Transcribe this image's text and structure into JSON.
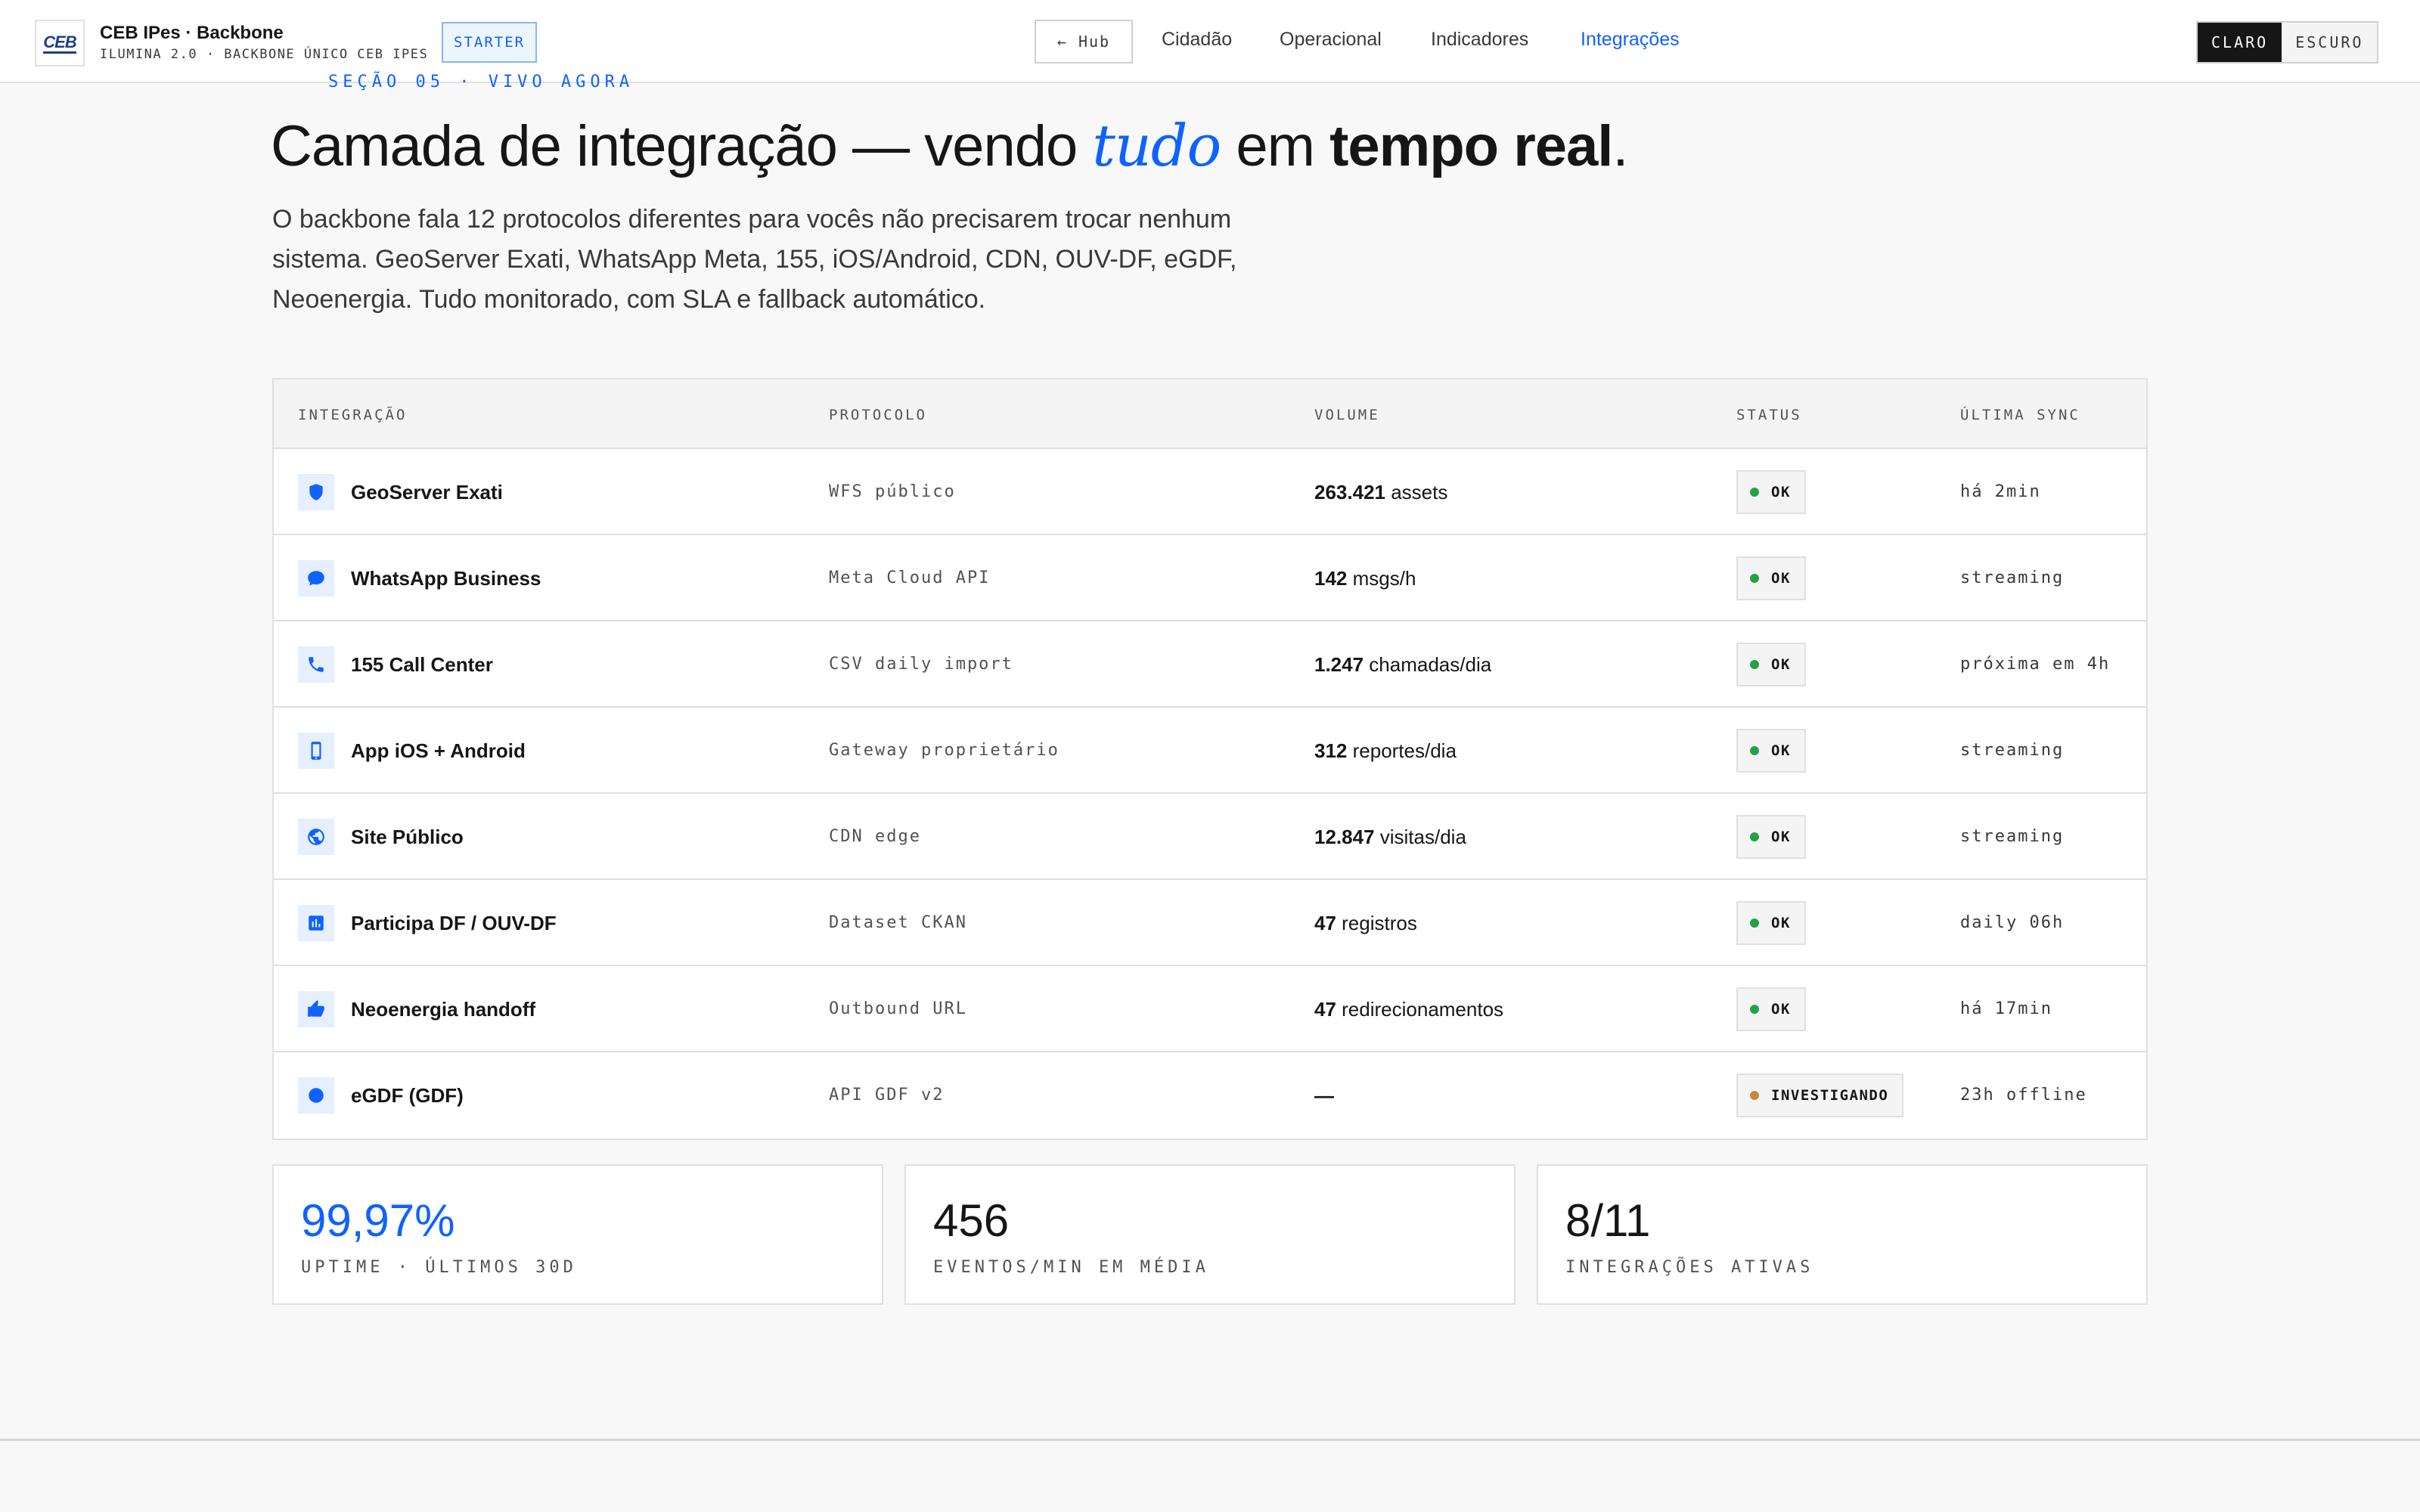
{
  "header": {
    "logo_text": "CEB",
    "brand_name": "CEB IPes · Backbone",
    "brand_sub": "ILUMINA 2.0 · BACKBONE ÚNICO CEB IPES",
    "plan_badge": "STARTER",
    "hub_button": "← Hub",
    "nav": [
      {
        "label": "Cidadão",
        "active": false
      },
      {
        "label": "Operacional",
        "active": false
      },
      {
        "label": "Indicadores",
        "active": false
      },
      {
        "label": "Integrações",
        "active": true
      }
    ],
    "theme": {
      "light": "CLARO",
      "dark": "ESCURO",
      "selected": "CLARO"
    }
  },
  "hero": {
    "eyebrow": "SEÇÃO 05 · VIVO AGORA",
    "headline_part1": "Camada de integração — vendo ",
    "headline_italic": "tudo",
    "headline_part2": " em ",
    "headline_bold": "tempo real",
    "headline_end": ".",
    "lede": "O backbone fala 12 protocolos diferentes para vocês não precisarem trocar nenhum sistema. GeoServer Exati, WhatsApp Meta, 155, iOS/Android, CDN, OUV-DF, eGDF, Neoenergia. Tudo monitorado, com SLA e fallback automático."
  },
  "table": {
    "columns": [
      "INTEGRAÇÃO",
      "PROTOCOLO",
      "VOLUME",
      "STATUS",
      "ÚLTIMA SYNC"
    ],
    "rows": [
      {
        "icon": "shield-icon",
        "name": "GeoServer Exati",
        "protocol": "WFS público",
        "volume_num": "263.421",
        "volume_unit": " assets",
        "status": "OK",
        "status_color": "#24a148",
        "sync": "há 2min"
      },
      {
        "icon": "chat-icon",
        "name": "WhatsApp Business",
        "protocol": "Meta Cloud API",
        "volume_num": "142",
        "volume_unit": " msgs/h",
        "status": "OK",
        "status_color": "#24a148",
        "sync": "streaming"
      },
      {
        "icon": "phone-icon",
        "name": "155 Call Center",
        "protocol": "CSV daily import",
        "volume_num": "1.247",
        "volume_unit": " chamadas/dia",
        "status": "OK",
        "status_color": "#24a148",
        "sync": "próxima em 4h"
      },
      {
        "icon": "mobile-icon",
        "name": "App iOS + Android",
        "protocol": "Gateway proprietário",
        "volume_num": "312",
        "volume_unit": " reportes/dia",
        "status": "OK",
        "status_color": "#24a148",
        "sync": "streaming"
      },
      {
        "icon": "globe-icon",
        "name": "Site Público",
        "protocol": "CDN edge",
        "volume_num": "12.847",
        "volume_unit": " visitas/dia",
        "status": "OK",
        "status_color": "#24a148",
        "sync": "streaming"
      },
      {
        "icon": "bar-chart-icon",
        "name": "Participa DF / OUV-DF",
        "protocol": "Dataset CKAN",
        "volume_num": "47",
        "volume_unit": " registros",
        "status": "OK",
        "status_color": "#24a148",
        "sync": "daily 06h"
      },
      {
        "icon": "thumbs-up-icon",
        "name": "Neoenergia handoff",
        "protocol": "Outbound URL",
        "volume_num": "47",
        "volume_unit": " redirecionamentos",
        "status": "OK",
        "status_color": "#24a148",
        "sync": "há 17min"
      },
      {
        "icon": "circle-icon",
        "name": "eGDF (GDF)",
        "protocol": "API GDF v2",
        "volume_num": "—",
        "volume_unit": "",
        "status": "INVESTIGANDO",
        "status_color": "#c58a3a",
        "sync": "23h offline"
      }
    ]
  },
  "stats": [
    {
      "value": "99,97%",
      "label": "UPTIME · ÚLTIMOS 30D",
      "accent": true
    },
    {
      "value": "456",
      "label": "EVENTOS/MIN EM MÉDIA",
      "accent": false
    },
    {
      "value": "8/11",
      "label": "INTEGRAÇÕES ATIVAS",
      "accent": false
    }
  ],
  "colors": {
    "accent": "#0f62fe",
    "ok": "#24a148",
    "warning": "#c58a3a"
  }
}
